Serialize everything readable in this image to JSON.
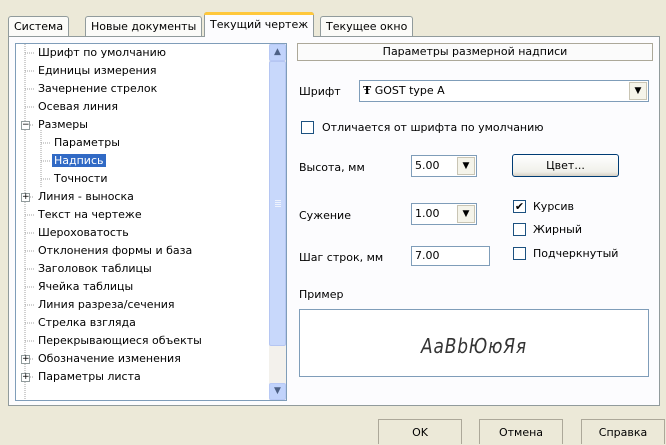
{
  "tabs": [
    "Система",
    "Новые документы",
    "Текущий чертеж",
    "Текущее окно"
  ],
  "tree": {
    "items": [
      {
        "label": "Шрифт по умолчанию"
      },
      {
        "label": "Единицы измерения"
      },
      {
        "label": "Зачернение стрелок"
      },
      {
        "label": "Осевая линия"
      },
      {
        "label": "Размеры",
        "expander": "−"
      },
      {
        "label": "Параметры"
      },
      {
        "label": "Надпись",
        "selected": true
      },
      {
        "label": "Точности"
      },
      {
        "label": "Линия - выноска",
        "expander": "+"
      },
      {
        "label": "Текст на чертеже"
      },
      {
        "label": "Шероховатость"
      },
      {
        "label": "Отклонения формы и база"
      },
      {
        "label": "Заголовок таблицы"
      },
      {
        "label": "Ячейка таблицы"
      },
      {
        "label": "Линия разреза/сечения"
      },
      {
        "label": "Стрелка взгляда"
      },
      {
        "label": "Перекрывающиеся объекты"
      },
      {
        "label": "Обозначение изменения",
        "expander": "+"
      },
      {
        "label": "Параметры листа",
        "expander": "+"
      }
    ]
  },
  "settings": {
    "header": "Параметры размерной надписи",
    "font_label": "Шрифт",
    "font_icon": "truetype-font-icon",
    "font_value": "GOST type A",
    "differs_label": "Отличается от шрифта по умолчанию",
    "differs_checked": false,
    "height_label": "Высота, мм",
    "height_value": "5.00",
    "narrowing_label": "Сужение",
    "narrowing_value": "1.00",
    "line_step_label": "Шаг строк, мм",
    "line_step_value": "7.00",
    "color_button": "Цвет...",
    "italic_label": "Курсив",
    "italic_checked": true,
    "bold_label": "Жирный",
    "bold_checked": false,
    "underline_label": "Подчеркнутый",
    "underline_checked": false,
    "sample_label": "Пример",
    "sample_text": "АаВbЮюЯя"
  },
  "buttons": {
    "ok": "OK",
    "cancel": "Отмена",
    "help": "Справка"
  }
}
